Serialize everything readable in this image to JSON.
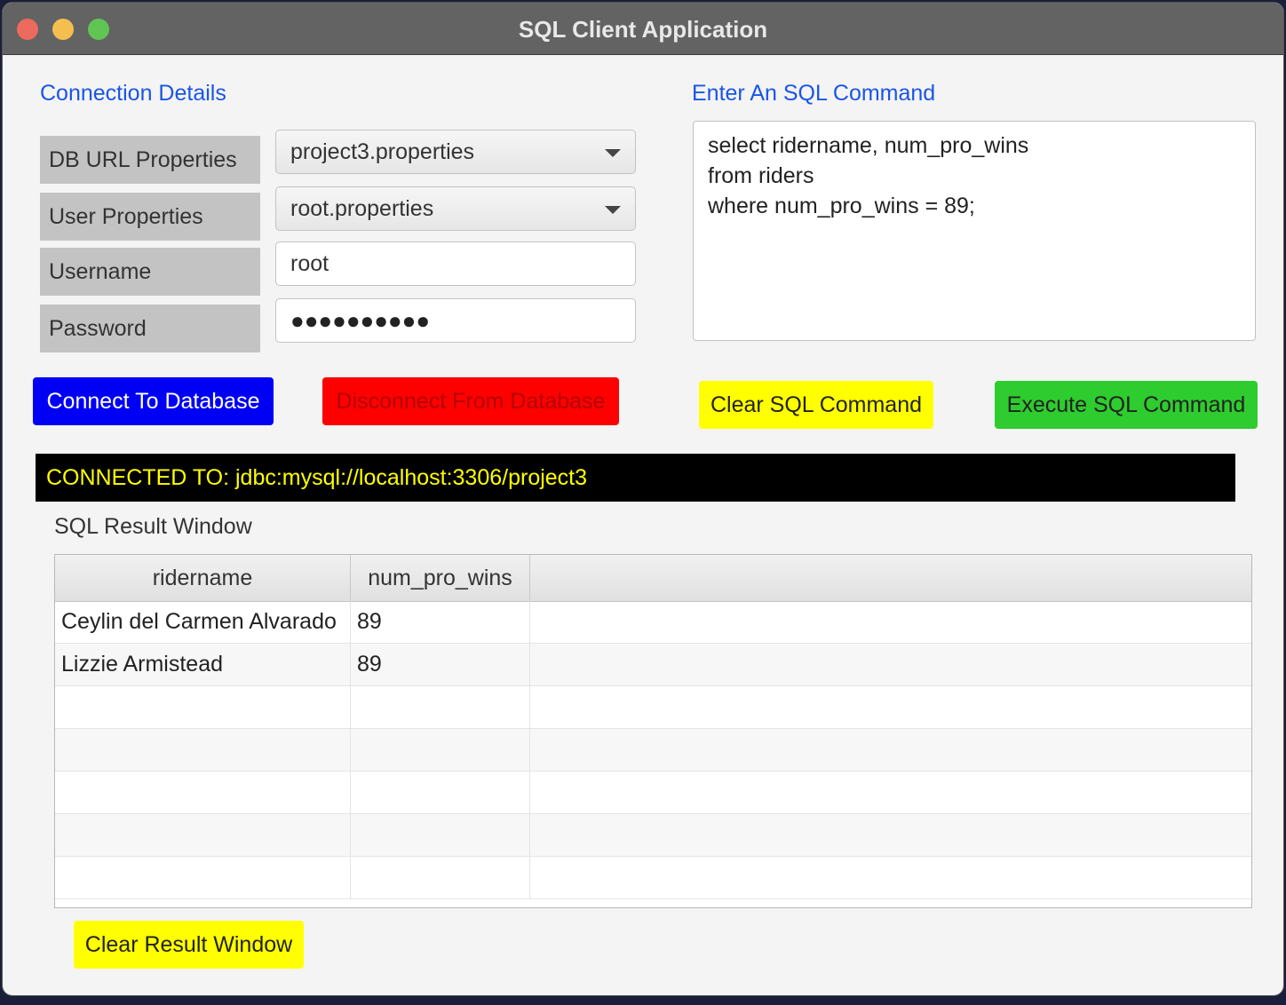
{
  "window": {
    "title": "SQL Client Application"
  },
  "connection": {
    "section_title": "Connection Details",
    "db_url_label": "DB URL Properties",
    "db_url_value": "project3.properties",
    "user_props_label": "User Properties",
    "user_props_value": "root.properties",
    "username_label": "Username",
    "username_value": "root",
    "password_label": "Password",
    "password_mask": "●●●●●●●●●●"
  },
  "sql": {
    "section_title": "Enter An SQL Command",
    "command": "select ridername, num_pro_wins\nfrom riders\nwhere num_pro_wins = 89;"
  },
  "buttons": {
    "connect": "Connect To Database",
    "disconnect": "Disconnect From Database",
    "clear_sql": "Clear SQL Command",
    "execute_sql": "Execute SQL Command",
    "clear_result": "Clear Result Window"
  },
  "status": {
    "text": "CONNECTED TO: jdbc:mysql://localhost:3306/project3"
  },
  "results": {
    "label": "SQL Result Window",
    "columns": [
      "ridername",
      "num_pro_wins",
      ""
    ],
    "rows": [
      [
        "Ceylin del Carmen Alvarado",
        "89",
        ""
      ],
      [
        "Lizzie Armistead",
        "89",
        ""
      ],
      [
        "",
        "",
        ""
      ],
      [
        "",
        "",
        ""
      ],
      [
        "",
        "",
        ""
      ],
      [
        "",
        "",
        ""
      ],
      [
        "",
        "",
        ""
      ]
    ]
  },
  "colors": {
    "connect": "#0000f5",
    "disconnect": "#ff0000",
    "clear": "#ffff00",
    "execute": "#2ecc2e",
    "status_bg": "#000000",
    "status_text": "#ffff00",
    "section_title": "#1a55e6"
  }
}
